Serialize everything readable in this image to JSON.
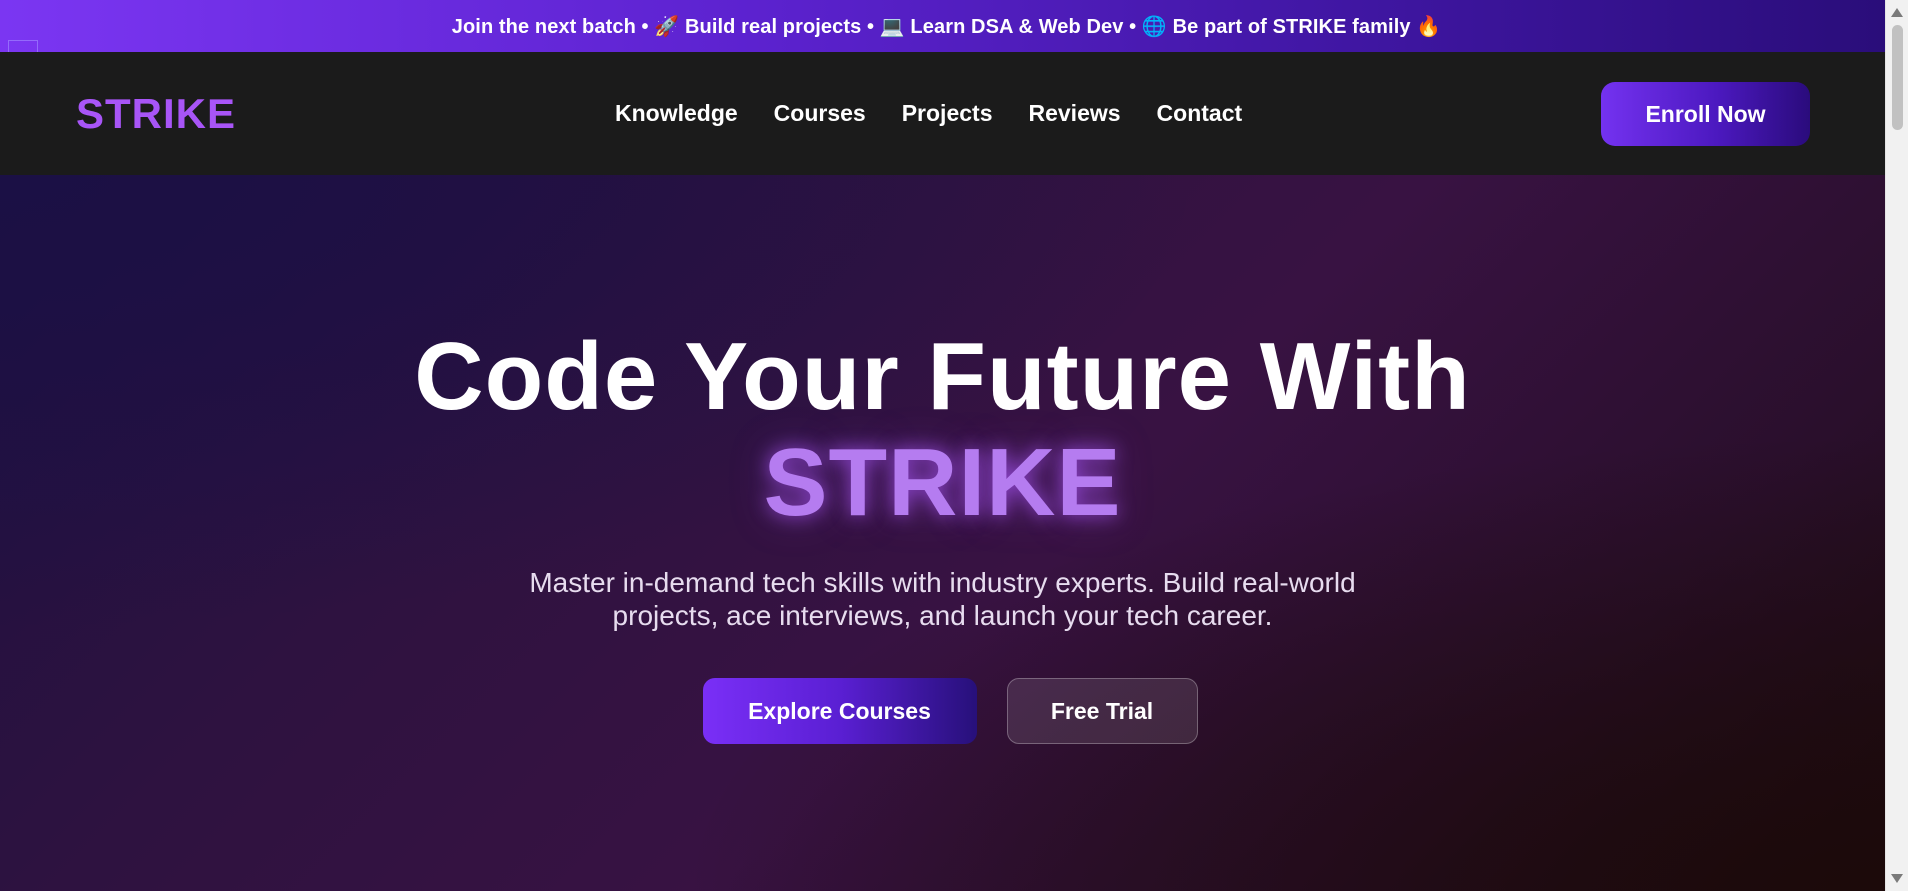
{
  "announcement": {
    "text": "Join the next batch • 🚀 Build real projects • 💻 Learn DSA & Web Dev • 🌐 Be part of STRIKE family 🔥"
  },
  "navbar": {
    "logo": "STRIKE",
    "links": [
      "Knowledge",
      "Courses",
      "Projects",
      "Reviews",
      "Contact"
    ],
    "cta_label": "Enroll Now"
  },
  "hero": {
    "title_line1": "Code Your Future With",
    "title_brand": "STRIKE",
    "subtitle": "Master in-demand tech skills with industry experts. Build real-world projects, ace interviews, and launch your tech career.",
    "primary_cta": "Explore Courses",
    "secondary_cta": "Free Trial"
  },
  "colors": {
    "brand_purple": "#a855f7",
    "announcement_gradient_start": "#7b36f2",
    "announcement_gradient_end": "#2a0d7a",
    "navbar_bg": "#1b1b1b",
    "hero_brand_text": "#b57cf0"
  }
}
